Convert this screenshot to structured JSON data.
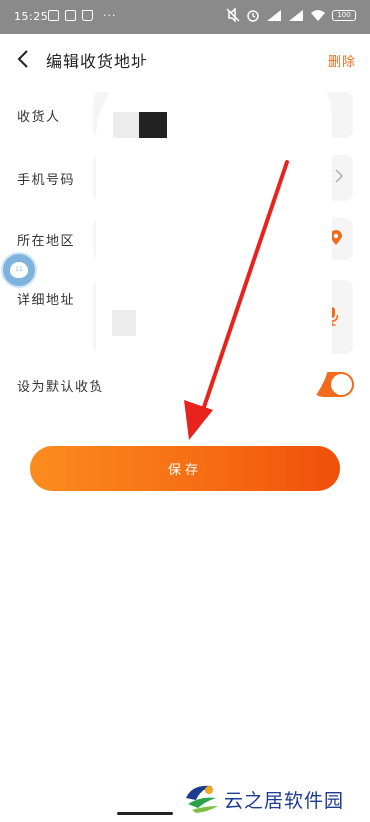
{
  "status_bar": {
    "time": "15:25",
    "dots": "···",
    "battery": "100",
    "icons": [
      "notification-icon",
      "notification-icon",
      "bag-icon",
      "mute-icon",
      "alarm-icon",
      "signal-icon",
      "signal-icon",
      "wifi-icon",
      "battery-icon"
    ]
  },
  "header": {
    "title": "编辑收货地址",
    "delete_label": "删除"
  },
  "form": {
    "recipient_label": "收货人",
    "phone_label": "手机号码",
    "region_label": "所在地区",
    "detail_label": "详细地址",
    "default_label": "设为默认收货地址",
    "default_enabled": true
  },
  "save_label": "保存",
  "floating_bubble_text": "11",
  "watermark": {
    "text": "云之居软件园"
  },
  "colors": {
    "accent": "#f26b1d",
    "arrow": "#e8221c",
    "status_bar": "#8a8a8a"
  }
}
